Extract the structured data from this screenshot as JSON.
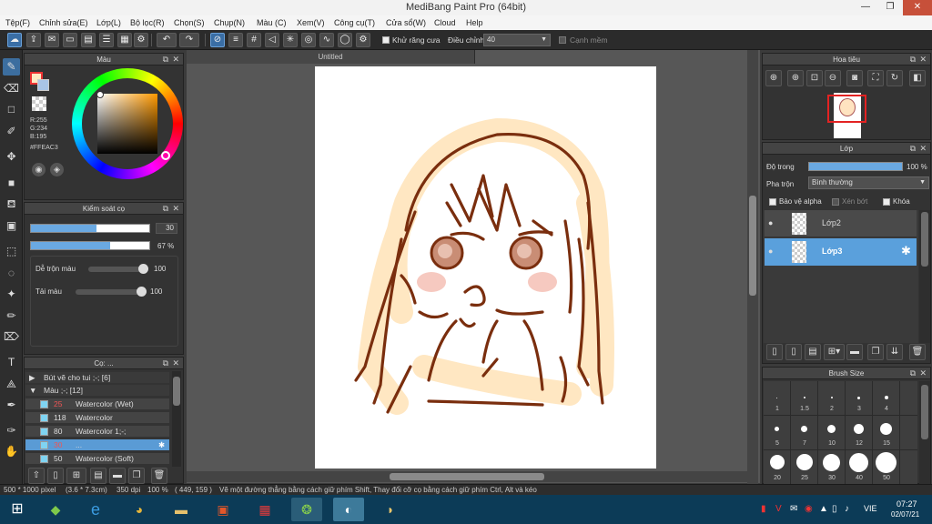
{
  "window": {
    "title": "MediBang Paint Pro (64bit)",
    "minimize": "—",
    "restore": "❐",
    "close": "✕"
  },
  "menu": [
    "Tệp(F)",
    "Chỉnh sửa(E)",
    "Lớp(L)",
    "Bộ lọc(R)",
    "Chọn(S)",
    "Chụp(N)",
    "Màu (C)",
    "Xem(V)",
    "Công cụ(T)",
    "Cửa sổ(W)",
    "Cloud",
    "Help"
  ],
  "toolbar": {
    "antialias_label": "Khử răng cưa",
    "adjust_label": "Điều chỉnh",
    "adjust_value": "40",
    "smooth_label": "Cạnh mềm"
  },
  "color_panel": {
    "title": "Màu",
    "r": "R:255",
    "g": "G:234",
    "b": "B:195",
    "hex": "#FFEAC3",
    "primary_color": "#FFEAC3"
  },
  "brush_control": {
    "title": "Kiểm soát cọ",
    "size_value": "30",
    "size_fraction": 0.55,
    "opacity_value": "67 %",
    "opacity_fraction": 0.67,
    "blend_label": "Dễ trộn màu",
    "blend_value": "100",
    "mix_label": "Tải màu",
    "mix_value": "100"
  },
  "brush_panel": {
    "title": "Cọ: ...",
    "groups": [
      {
        "label": "Bút vẽ cho tui ;-; [6]",
        "collapsed": true
      },
      {
        "label": "Màu ;-; [12]",
        "collapsed": false
      }
    ],
    "items": [
      {
        "size": "25",
        "name": "Watercolor (Wet)",
        "selected": false,
        "red": true
      },
      {
        "size": "118",
        "name": "Watercolor",
        "selected": false,
        "red": false
      },
      {
        "size": "80",
        "name": "Watercolor 1;-;",
        "selected": false,
        "red": false
      },
      {
        "size": "30",
        "name": "...",
        "selected": true,
        "red": true
      },
      {
        "size": "50",
        "name": "Watercolor (Soft)",
        "selected": false,
        "red": false
      }
    ]
  },
  "document": {
    "tab": "Untitled"
  },
  "navigator": {
    "title": "Hoa tiêu"
  },
  "layers": {
    "title": "Lớp",
    "opacity_label": "Độ trong",
    "opacity_value": "100 %",
    "opacity_fraction": 1.0,
    "blend_label": "Pha trộn",
    "blend_value": "Bình thường",
    "protect_alpha": "Bảo vệ alpha",
    "clipping": "Xén bớt",
    "lock": "Khóa",
    "items": [
      {
        "name": "Lớp2",
        "selected": false
      },
      {
        "name": "Lớp3",
        "selected": true
      }
    ]
  },
  "brush_size": {
    "title": "Brush Size",
    "row1": [
      "1",
      "1.5",
      "2",
      "3",
      "4"
    ],
    "row2": [
      "5",
      "7",
      "10",
      "12",
      "15"
    ],
    "row3": [
      "20",
      "25",
      "30",
      "40",
      "50"
    ]
  },
  "status": {
    "size": "500 * 1000 pixel",
    "physical": "(3.6 * 7.3cm)",
    "dpi": "350 dpi",
    "zoom": "100 %",
    "coords": "( 449, 159 )",
    "hint": "Vẽ một đường thẳng bằng cách giữ phím Shift, Thay đổi cỡ cọ bằng cách giữ phím Ctrl, Alt và kéo"
  },
  "taskbar": {
    "lang": "VIE",
    "time": "07:27",
    "date": "02/07/21"
  }
}
